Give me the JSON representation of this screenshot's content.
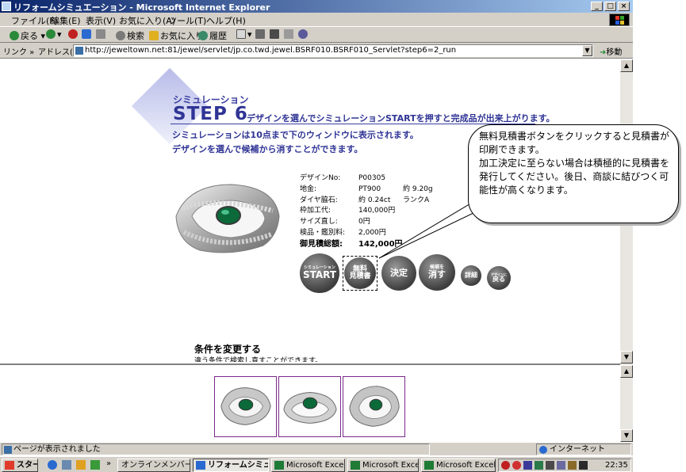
{
  "window": {
    "title": "リフォームシミュエーション - Microsoft Internet Explorer",
    "minimize": "_",
    "maximize": "□",
    "close": "×"
  },
  "menu": [
    "ファイル(F)",
    "編集(E)",
    "表示(V)",
    "お気に入り(A)",
    "ツール(T)",
    "ヘルプ(H)"
  ],
  "toolbar": {
    "back": "戻る",
    "search": "検索",
    "favorites": "お気に入り",
    "history": "履歴"
  },
  "address": {
    "links_label": "リンク »",
    "label": "アドレス(D)",
    "url": "http://jeweltown.net:81/jewel/servlet/jp.co.twd.jewel.BSRF010.BSRF010_Servlet?step6=2_run",
    "go": "移動"
  },
  "page": {
    "sim_label": "シミュレーション",
    "step_title": "STEP 6",
    "step_desc": "デザインを選んでシミュレーションSTARTを押すと完成品が出来上がります。",
    "desc_line1": "シミュレーションは10点まで下のウィンドウに表示されます。",
    "desc_line2": "デザインを選んで候補から消すことができます。",
    "specs": [
      {
        "label": "デザインNo:",
        "value": "P00305",
        "extra": ""
      },
      {
        "label": "地金:",
        "value": "PT900",
        "extra": "約 9.20g"
      },
      {
        "label": "ダイヤ脇石:",
        "value": "約 0.24ct",
        "extra": "ランクA"
      },
      {
        "label": "枠加工代:",
        "value": "140,000円",
        "extra": ""
      },
      {
        "label": "サイズ直し:",
        "value": "0円",
        "extra": ""
      },
      {
        "label": "検品・鑑別料:",
        "value": "2,000円",
        "extra": ""
      },
      {
        "label": "御見積総額:",
        "value": "142,000円",
        "extra": ""
      }
    ],
    "buttons": {
      "start_small": "シミュレーション",
      "start": "START",
      "quote_l1": "無料",
      "quote_l2": "見積書",
      "decide": "決定",
      "remove_small": "候補を",
      "remove": "消す",
      "detail": "詳細",
      "back_small": "デザインに",
      "back": "戻る"
    },
    "callout": "無料見積書ボタンをクリックすると見積書が印刷できます。\n加工決定に至らない場合は積極的に見積書を発行してください。後日、商談に結びつく可能性が高くなります。",
    "cond_title": "条件を変更する",
    "cond_sub": "違う条件で検索し直すことができます。"
  },
  "status": {
    "text": "ページが表示されました",
    "zone": "インターネット"
  },
  "taskbar": {
    "start": "スタート",
    "tasks": [
      "オンラインメンバー登録",
      "リフォームシミュ...",
      "Microsoft Excel",
      "Microsoft Excel",
      "Microsoft Excel"
    ],
    "clock": "22:35"
  }
}
